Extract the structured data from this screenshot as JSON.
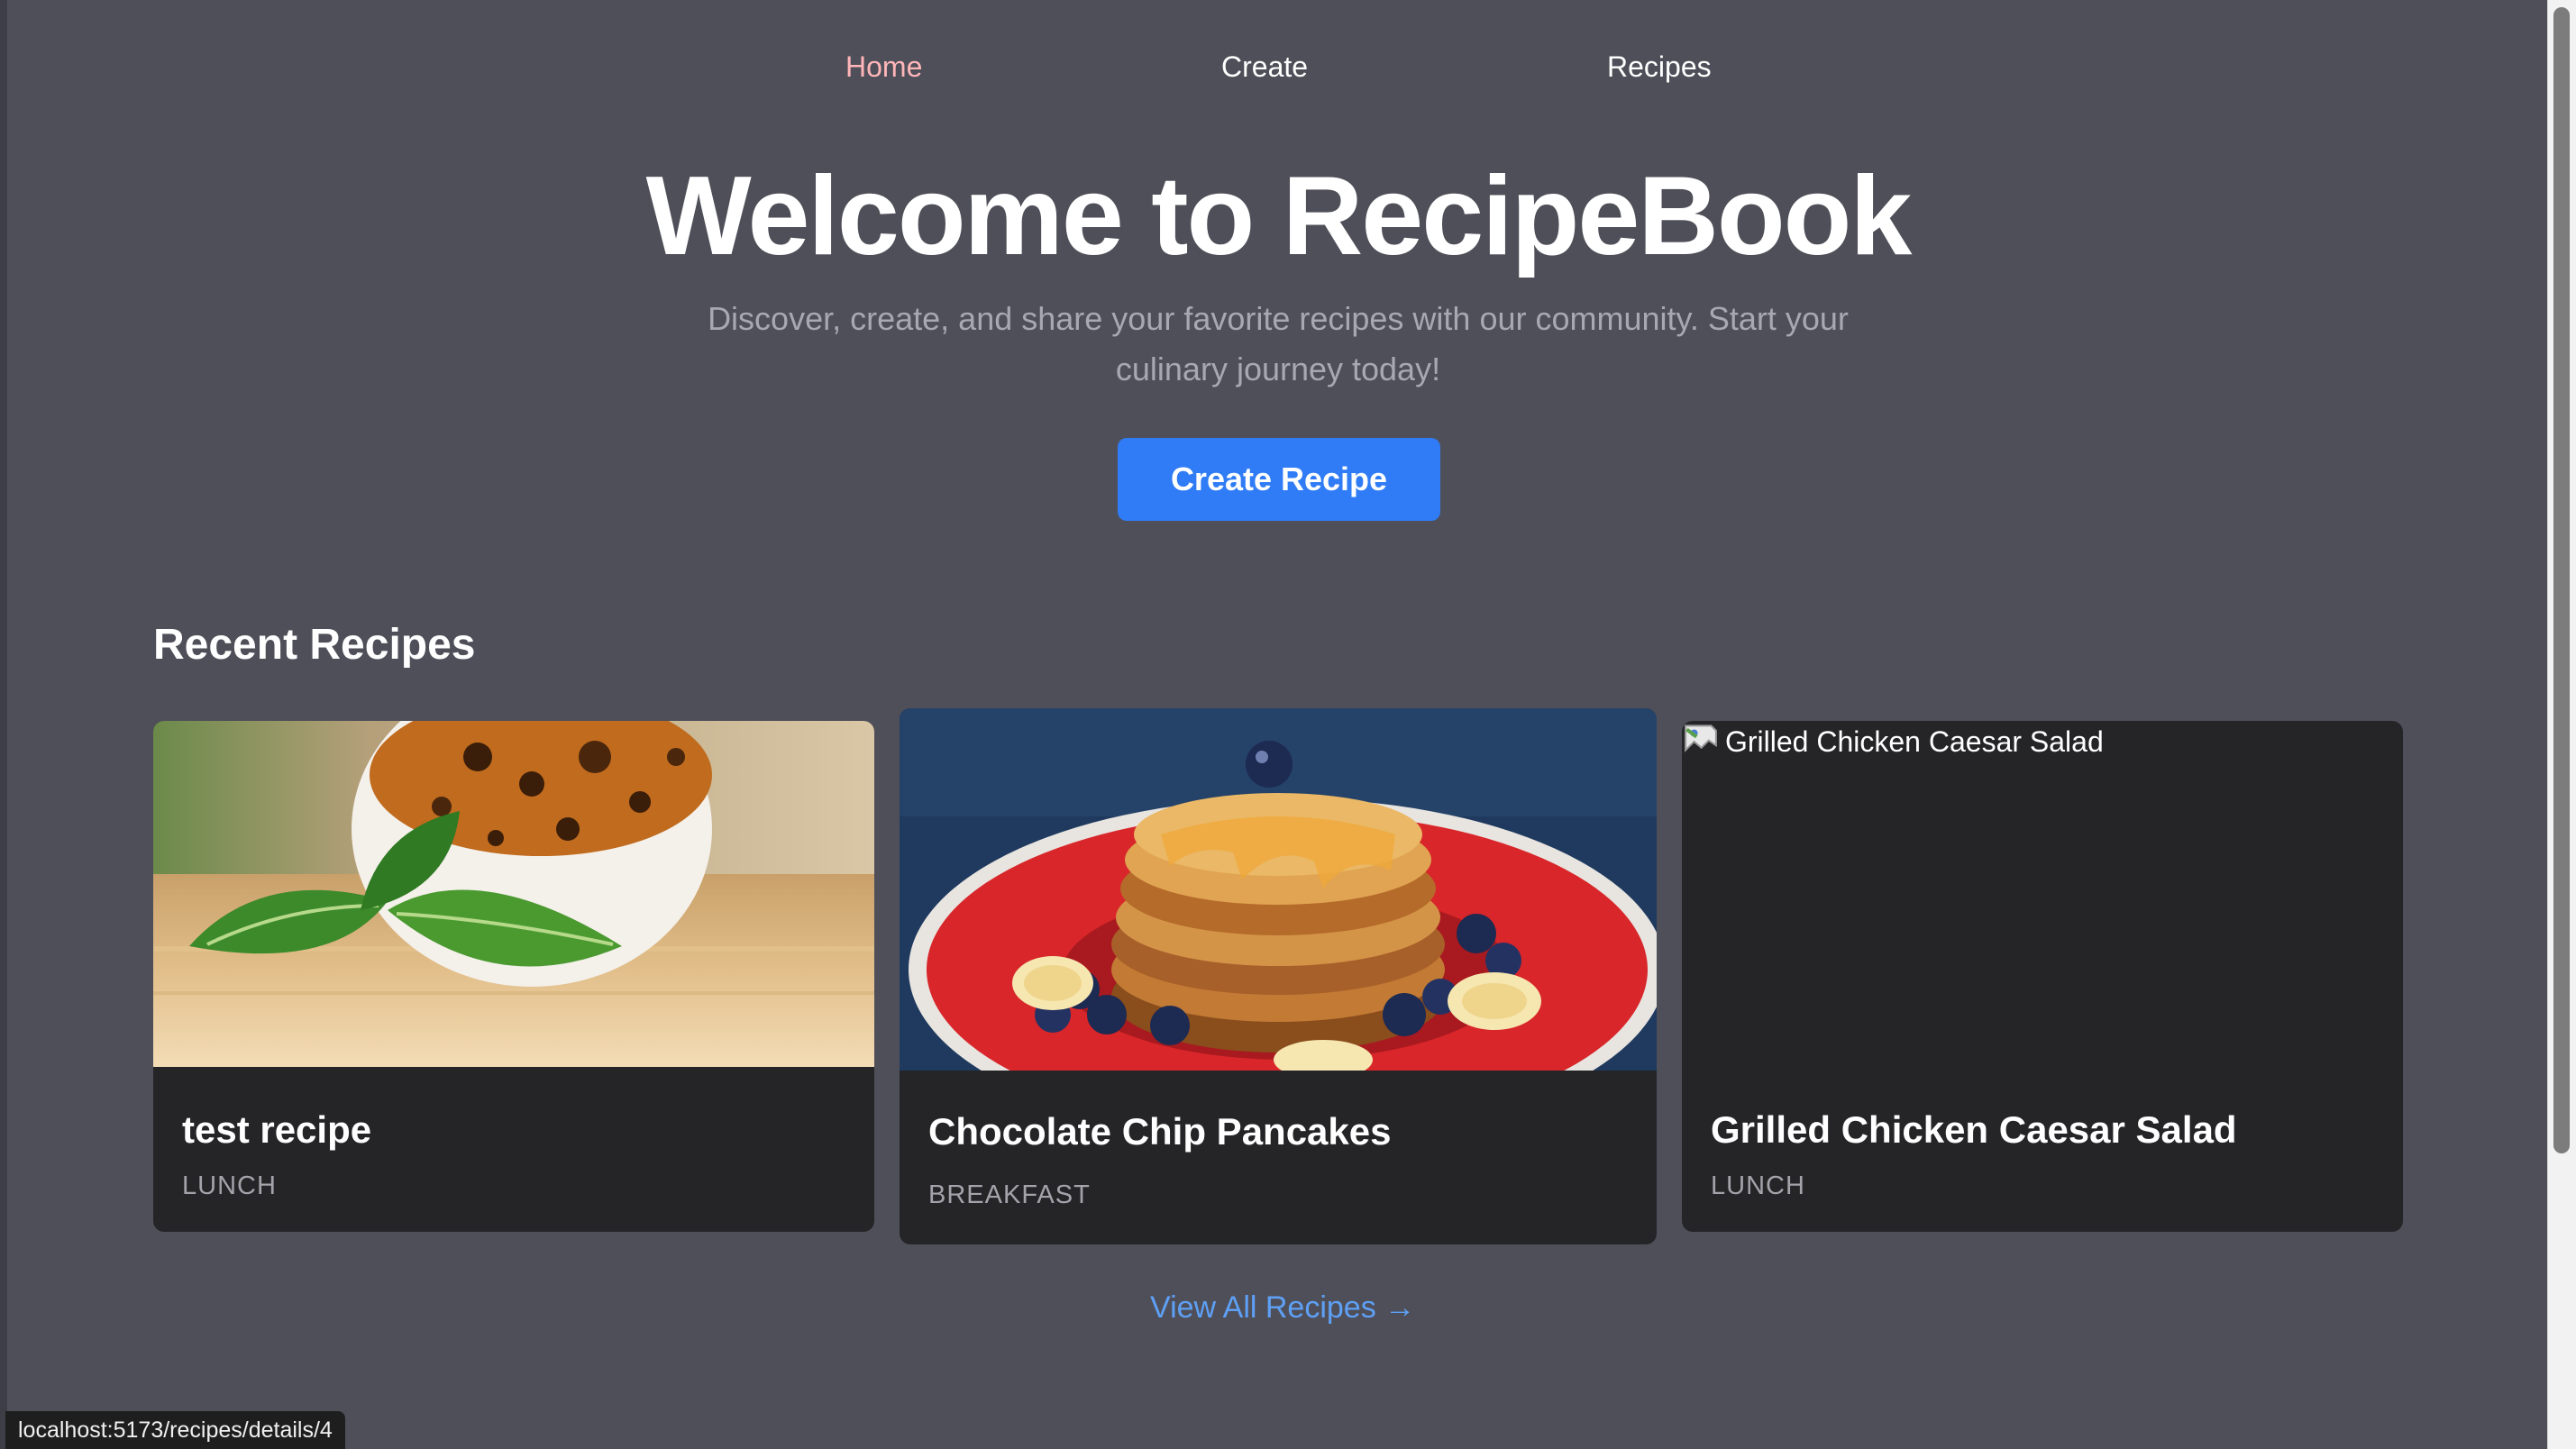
{
  "nav": {
    "items": [
      {
        "label": "Home",
        "active": true
      },
      {
        "label": "Create",
        "active": false
      },
      {
        "label": "Recipes",
        "active": false
      }
    ]
  },
  "hero": {
    "title": "Welcome to RecipeBook",
    "subtitle": "Discover, create, and share your favorite recipes with our community. Start your culinary journey today!",
    "cta_label": "Create Recipe"
  },
  "recent": {
    "heading": "Recent Recipes",
    "cards": [
      {
        "title": "test recipe",
        "category": "LUNCH",
        "image": "dessert-with-mint-photo"
      },
      {
        "title": "Chocolate Chip Pancakes",
        "category": "BREAKFAST",
        "image": "pancakes-with-berries-photo"
      },
      {
        "title": "Grilled Chicken Caesar Salad",
        "category": "LUNCH",
        "image_alt": "Grilled Chicken Caesar Salad",
        "image": "broken-image-icon"
      }
    ],
    "view_all_label": "View All Recipes →"
  },
  "status_bar": {
    "url": "localhost:5173/recipes/details/4"
  },
  "colors": {
    "background": "#4f4f59",
    "card": "#252528",
    "accent": "#2f7cf6",
    "link": "#5ea0f5",
    "active_nav": "#ffb6b9"
  }
}
